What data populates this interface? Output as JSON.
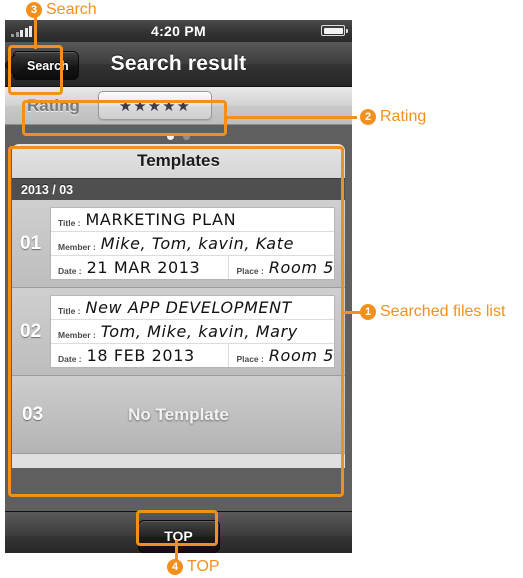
{
  "statusbar": {
    "time": "4:20 PM",
    "signal_icon": "signal-bars-icon",
    "battery_icon": "battery-icon"
  },
  "navbar": {
    "back_label": "Search",
    "title": "Search result"
  },
  "rating": {
    "label": "Rating",
    "stars": "★★★★★",
    "star_count": 5
  },
  "pager": {
    "dots": 2,
    "active_index": 0
  },
  "card": {
    "header": "Templates",
    "date_band": "2013 / 03",
    "field_labels": {
      "title": "Title :",
      "member": "Member :",
      "date": "Date :",
      "place": "Place :"
    },
    "rows": [
      {
        "index": "01",
        "title": "MARKETING PLAN",
        "member": "Mike, Tom, kavin, Kate",
        "date": "21 MAR 2013",
        "place": "Room 5"
      },
      {
        "index": "02",
        "title": "New APP DEVELOPMENT",
        "member": "Tom, Mike, kavin, Mary",
        "date": "18 FEB 2013",
        "place": "Room 5"
      }
    ],
    "empty_row": {
      "index": "03",
      "text": "No Template"
    }
  },
  "toolbar": {
    "top_label": "TOP"
  },
  "annotations": {
    "accent_color": "#F2901D",
    "items": [
      {
        "number": "1",
        "label": "Searched files list"
      },
      {
        "number": "2",
        "label": "Rating"
      },
      {
        "number": "3",
        "label": "Search"
      },
      {
        "number": "4",
        "label": "TOP"
      }
    ]
  }
}
